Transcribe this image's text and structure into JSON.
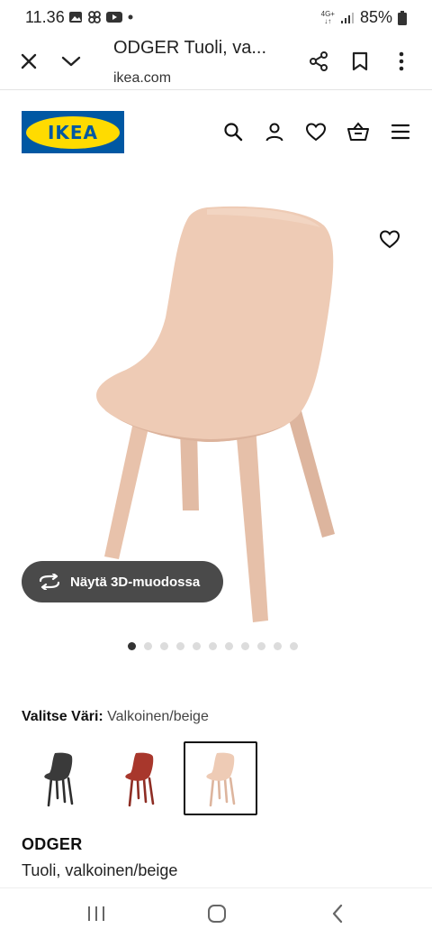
{
  "status_bar": {
    "time": "11.36",
    "network": "4G+",
    "battery": "85%",
    "icons": [
      "gallery-icon",
      "pinwheel-icon",
      "youtube-icon",
      "dot-icon"
    ]
  },
  "browser": {
    "title": "ODGER Tuoli, va...",
    "url": "ikea.com"
  },
  "header": {
    "logo_text": "IKEA",
    "icons": [
      "search-icon",
      "user-icon",
      "heart-icon",
      "basket-icon",
      "menu-icon"
    ]
  },
  "product": {
    "button_3d_label": "Näytä 3D-muodossa",
    "dots_total": 11,
    "dots_active_index": 0,
    "color_label": "Valitse Väri:",
    "color_value": "Valkoinen/beige",
    "swatches": [
      {
        "name": "anthracite",
        "color": "#3a3a3a"
      },
      {
        "name": "red",
        "color": "#a8372c"
      },
      {
        "name": "white-beige",
        "color": "#e9cdb9",
        "selected": true
      }
    ],
    "name": "ODGER",
    "description": "Tuoli, valkoinen/beige"
  },
  "colors": {
    "ikea_blue": "#0058a3",
    "ikea_yellow": "#ffdb00",
    "chair": "#ecc9b3"
  }
}
